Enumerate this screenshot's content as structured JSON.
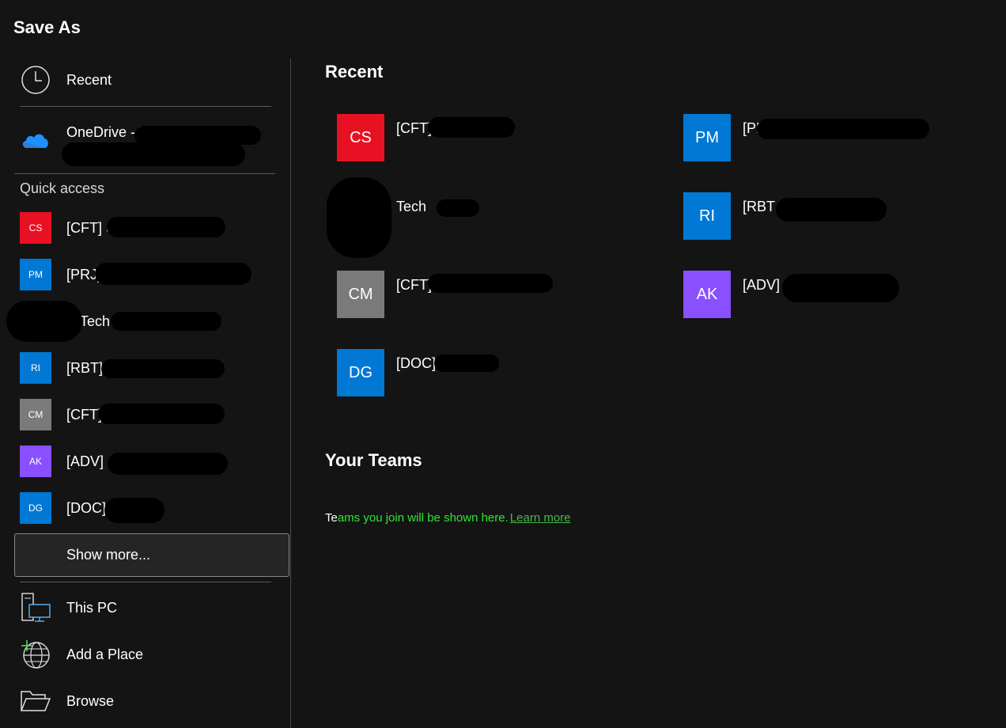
{
  "title": "Save As",
  "nav": {
    "recent_label": "Recent",
    "onedrive_label": "OneDrive - V",
    "this_pc_label": "This PC",
    "add_place_label": "Add a Place",
    "browse_label": "Browse",
    "show_more_label": "Show more..."
  },
  "quick_access": {
    "heading": "Quick access",
    "items": [
      {
        "initials": "CS",
        "label": "[CFT] S",
        "color": "#e81123"
      },
      {
        "initials": "PM",
        "label": "[PRJ]",
        "color": "#0078d4"
      },
      {
        "initials": "",
        "label": "Tech",
        "color": "#3a3a3a"
      },
      {
        "initials": "RI",
        "label": "[RBT]",
        "color": "#0078d4"
      },
      {
        "initials": "CM",
        "label": "[CFT]",
        "color": "#7a7a7a"
      },
      {
        "initials": "AK",
        "label": "[ADV]",
        "color": "#8a4fff"
      },
      {
        "initials": "DG",
        "label": "[DOC]",
        "color": "#0078d4"
      }
    ]
  },
  "recent": {
    "heading": "Recent",
    "items": [
      {
        "initials": "CS",
        "label": "[CFT]",
        "color": "#e81123"
      },
      {
        "initials": "PM",
        "label": "[PR",
        "color": "#0078d4"
      },
      {
        "initials": "",
        "label": "Tech",
        "color": "#3a3a3a"
      },
      {
        "initials": "RI",
        "label": "[RBT",
        "color": "#0078d4"
      },
      {
        "initials": "CM",
        "label": "[CFT]",
        "color": "#7a7a7a"
      },
      {
        "initials": "AK",
        "label": "[ADV]",
        "color": "#8a4fff"
      },
      {
        "initials": "DG",
        "label": "[DOC]",
        "color": "#0078d4"
      }
    ]
  },
  "teams": {
    "heading": "Your Teams",
    "message_first": "Te",
    "message_rest": "ams you join will be shown here.",
    "learn_more": "Learn more"
  }
}
